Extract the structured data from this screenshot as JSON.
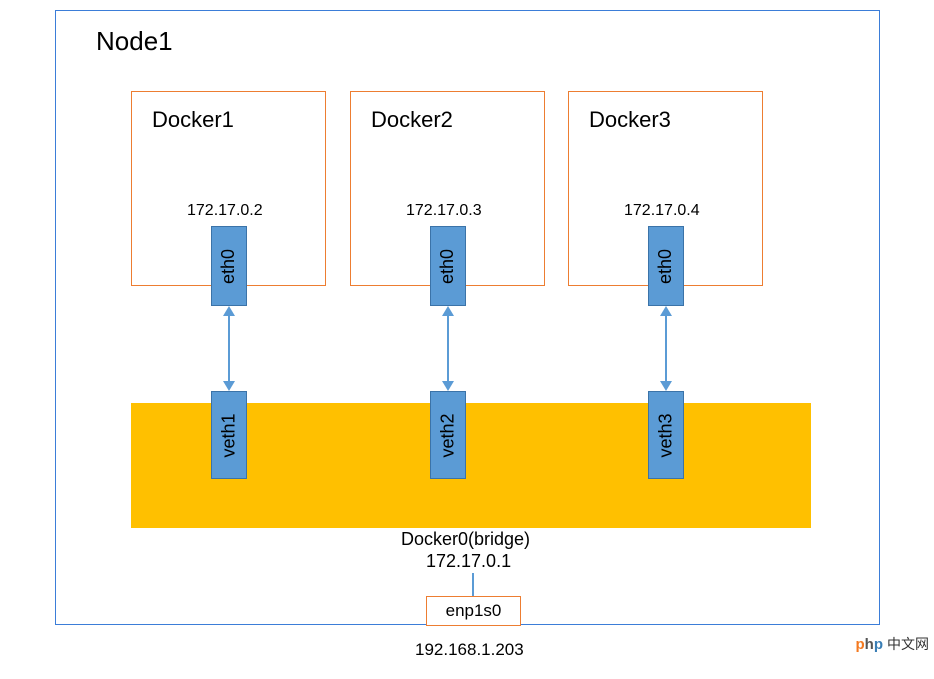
{
  "node": {
    "title": "Node1"
  },
  "containers": [
    {
      "name": "Docker1",
      "ip": "172.17.0.2",
      "iface": "eth0",
      "veth": "veth1"
    },
    {
      "name": "Docker2",
      "ip": "172.17.0.3",
      "iface": "eth0",
      "veth": "veth2"
    },
    {
      "name": "Docker3",
      "ip": "172.17.0.4",
      "iface": "eth0",
      "veth": "veth3"
    }
  ],
  "bridge": {
    "label": "Docker0(bridge)",
    "ip": "172.17.0.1"
  },
  "host": {
    "iface": "enp1s0",
    "ip": "192.168.1.203"
  },
  "watermark": {
    "brand_p1": "p",
    "brand_h": "h",
    "brand_p2": "p",
    "text": "中文网"
  },
  "colors": {
    "node_border": "#3b7dd8",
    "container_border": "#ed7d31",
    "iface_fill": "#5b9bd5",
    "bridge_fill": "#ffc000"
  }
}
